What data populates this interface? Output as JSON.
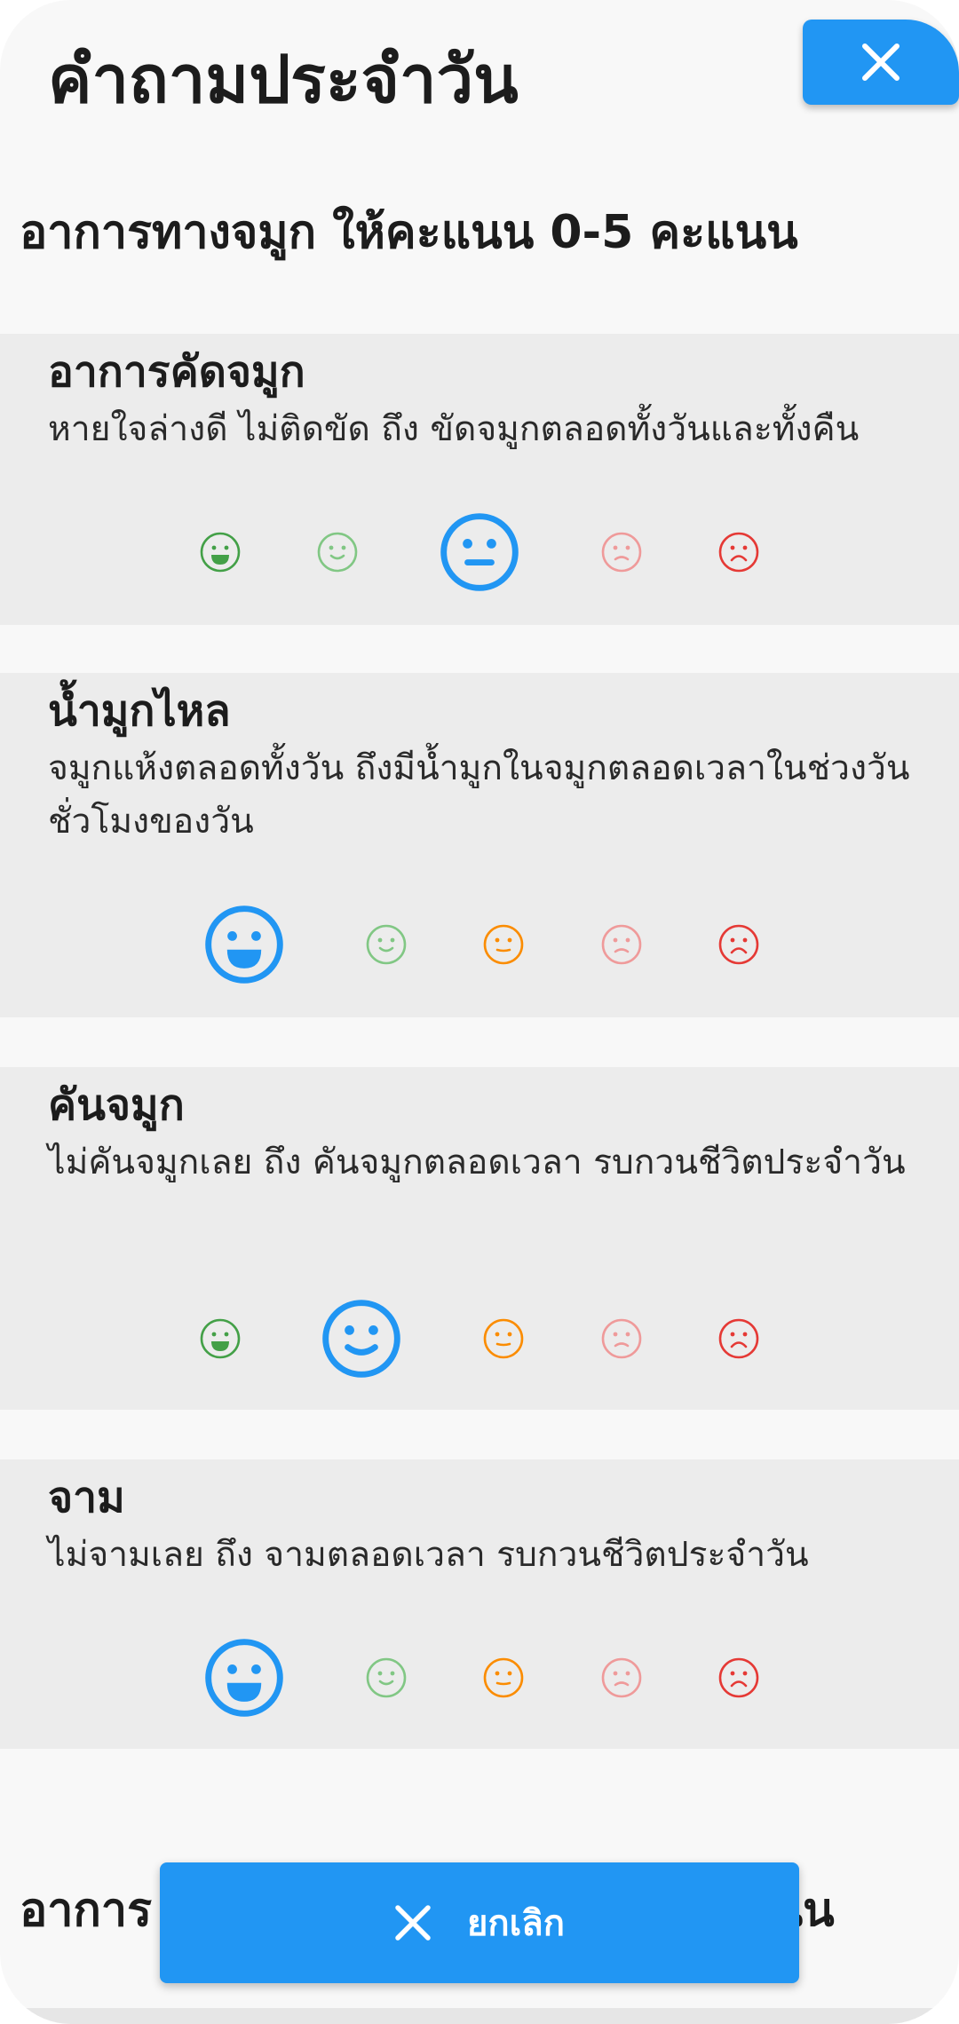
{
  "dialog": {
    "title": "คำถามประจำวัน",
    "close_icon": "close-icon",
    "accent_color": "#2196f3"
  },
  "section": {
    "heading": "อาการทางจมูก ให้คะแนน 0-5 คะแนน"
  },
  "questions": [
    {
      "title": "อาการคัดจมูก",
      "description": "หายใจล่างดี ไม่ติดขัด ถึง ขัดจมูกตลอดทั้งวันและทั้งคืน",
      "selected_index": 2
    },
    {
      "title": "น้ำมูกไหล",
      "description": "จมูกแห้งตลอดทั้งวัน ถึงมีน้ำมูกในจมูกตลอดเวลาในช่วงวัน ชั่วโมงของวัน",
      "selected_index": 0
    },
    {
      "title": "คันจมูก",
      "description": "ไม่คันจมูกเลย ถึง คันจมูกตลอดเวลา รบกวนชีวิตประจำวัน",
      "selected_index": 1
    },
    {
      "title": "จาม",
      "description": "ไม่จามเลย ถึง จามตลอดเวลา รบกวนชีวิตประจำวัน",
      "selected_index": 0
    }
  ],
  "rating_faces": [
    {
      "icon": "very-happy-face-icon",
      "color": "#43a047"
    },
    {
      "icon": "happy-face-icon",
      "color": "#81c784"
    },
    {
      "icon": "neutral-face-icon",
      "color": "#fb8c00"
    },
    {
      "icon": "sad-face-icon",
      "color": "#ef9a9a"
    },
    {
      "icon": "very-sad-face-icon",
      "color": "#e53935"
    }
  ],
  "selected_color": "#2196f3",
  "next_section": {
    "heading_visible_left": "อาการ",
    "heading_visible_right": "แนน"
  },
  "footer": {
    "cancel_label": "ยกเลิก",
    "cancel_icon": "close-icon"
  }
}
